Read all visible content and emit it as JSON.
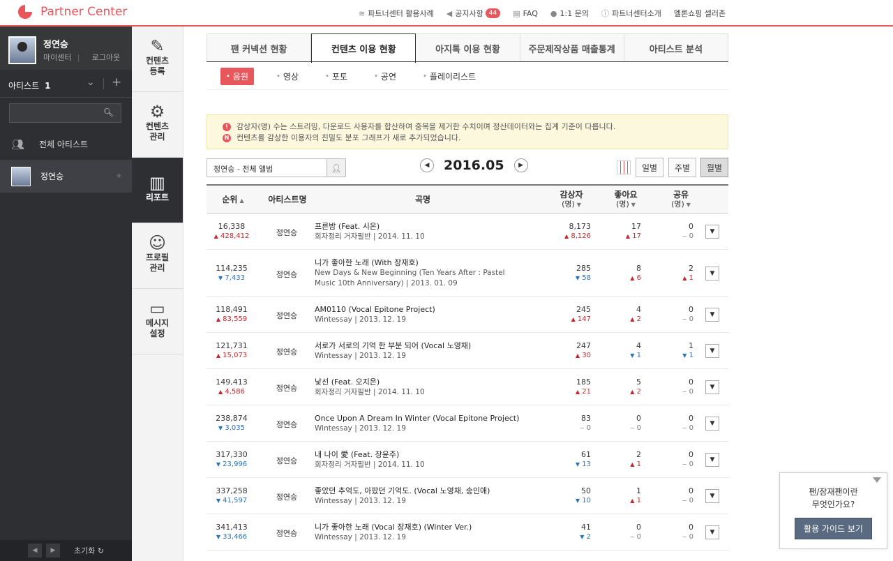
{
  "header": {
    "logo_text": "Partner Center",
    "nav": [
      {
        "label": "파트너센터 활용사례",
        "icon": "layers-icon"
      },
      {
        "label": "공지사항",
        "icon": "megaphone-icon",
        "badge": "44"
      },
      {
        "label": "FAQ",
        "icon": "book-icon"
      },
      {
        "label": "1:1 문의",
        "icon": "chat-icon"
      },
      {
        "label": "파트너센터소개",
        "icon": "info-icon"
      }
    ],
    "seller_link": "멜론쇼핑 셀러존"
  },
  "sidebar": {
    "user_name": "정연승",
    "my_center": "마이센터",
    "logout": "로그아웃",
    "artist_label": "아티스트",
    "artist_count": "1",
    "search_placeholder": "",
    "items": [
      {
        "label": "전체 아티스트"
      },
      {
        "label": "정연승"
      }
    ],
    "reset_label": "초기화"
  },
  "menu": [
    {
      "label": "컨텐츠 등록"
    },
    {
      "label": "컨텐츠 관리"
    },
    {
      "label": "리포트"
    },
    {
      "label": "프로필 관리"
    },
    {
      "label": "메시지 설정"
    }
  ],
  "tabs": [
    {
      "label": "팬 커넥션 현황"
    },
    {
      "label": "컨텐츠 이용 현황"
    },
    {
      "label": "아지톡 이용 현황"
    },
    {
      "label": "주문제작상품 매출통계"
    },
    {
      "label": "아티스트 분석"
    }
  ],
  "subtabs": [
    {
      "label": "음원"
    },
    {
      "label": "영상"
    },
    {
      "label": "포토"
    },
    {
      "label": "공연"
    },
    {
      "label": "플레이리스트"
    }
  ],
  "notice": {
    "line1": "감상자(명) 수는 스트리밍, 다운로드 사용자를 합산하여 중복을 제거한 수치이며 정산데이터와는 집계 기준이 다릅니다.",
    "line2": "컨텐츠를 감상한 이용자의 친밀도 분포 그래프가 새로 추가되었습니다.",
    "icon2_letter": "N"
  },
  "controls": {
    "album_select": "정연승 - 전체 앨범",
    "date": "2016.05",
    "periods": [
      "일별",
      "주별",
      "월별"
    ]
  },
  "table": {
    "headers": {
      "rank": "순위",
      "artist": "아티스트명",
      "song": "곡명",
      "listeners": "감상자",
      "likes": "좋아요",
      "shares": "공유",
      "unit": "(명)"
    },
    "rows": [
      {
        "rank": "16,338",
        "rank_chg": "428,412",
        "rank_dir": "up",
        "artist": "정연승",
        "title": "프른밤 (Feat. 시온)",
        "sub": "회자정리 거자필반   |  2014. 11. 10",
        "listeners": "8,173",
        "listeners_chg": "8,126",
        "listeners_dir": "up",
        "likes": "17",
        "likes_chg": "17",
        "likes_dir": "up",
        "shares": "0",
        "shares_chg": "0",
        "shares_dir": "zero"
      },
      {
        "rank": "114,235",
        "rank_chg": "7,433",
        "rank_dir": "dn",
        "artist": "정연승",
        "title": "니가 좋아한 노래 (With 장재호)",
        "sub": "New Days & New Beginning (Ten Years After : Pastel Music 10th Anniversary)   |  2013. 01. 09",
        "listeners": "285",
        "listeners_chg": "58",
        "listeners_dir": "dn",
        "likes": "8",
        "likes_chg": "6",
        "likes_dir": "up",
        "shares": "2",
        "shares_chg": "1",
        "shares_dir": "up"
      },
      {
        "rank": "118,491",
        "rank_chg": "83,559",
        "rank_dir": "up",
        "artist": "정연승",
        "title": "AM0110 (Vocal Epitone Project)",
        "sub": "Wintessay   |  2013. 12. 19",
        "listeners": "245",
        "listeners_chg": "147",
        "listeners_dir": "up",
        "likes": "4",
        "likes_chg": "2",
        "likes_dir": "up",
        "shares": "0",
        "shares_chg": "0",
        "shares_dir": "zero"
      },
      {
        "rank": "121,731",
        "rank_chg": "15,073",
        "rank_dir": "up",
        "artist": "정연승",
        "title": "서로가 서로의 기억 한 부분 되어 (Vocal 노영채)",
        "sub": "Wintessay   |  2013. 12. 19",
        "listeners": "247",
        "listeners_chg": "30",
        "listeners_dir": "up",
        "likes": "4",
        "likes_chg": "1",
        "likes_dir": "dn",
        "shares": "1",
        "shares_chg": "1",
        "shares_dir": "dn"
      },
      {
        "rank": "149,413",
        "rank_chg": "4,586",
        "rank_dir": "up",
        "artist": "정연승",
        "title": "낯선 (Feat. 오지은)",
        "sub": "회자정리 거자필반   |  2014. 11. 10",
        "listeners": "185",
        "listeners_chg": "21",
        "listeners_dir": "up",
        "likes": "5",
        "likes_chg": "2",
        "likes_dir": "up",
        "shares": "0",
        "shares_chg": "0",
        "shares_dir": "zero"
      },
      {
        "rank": "238,874",
        "rank_chg": "3,035",
        "rank_dir": "dn",
        "artist": "정연승",
        "title": "Once Upon A Dream In Winter (Vocal Epitone Project)",
        "sub": "Wintessay   |  2013. 12. 19",
        "listeners": "83",
        "listeners_chg": "0",
        "listeners_dir": "zero",
        "likes": "0",
        "likes_chg": "0",
        "likes_dir": "zero",
        "shares": "0",
        "shares_chg": "0",
        "shares_dir": "zero"
      },
      {
        "rank": "317,330",
        "rank_chg": "23,996",
        "rank_dir": "dn",
        "artist": "정연승",
        "title": "내 나이 愛 (Feat. 장윤주)",
        "sub": "회자정리 거자필반   |  2014. 11. 10",
        "listeners": "61",
        "listeners_chg": "13",
        "listeners_dir": "dn",
        "likes": "2",
        "likes_chg": "1",
        "likes_dir": "up",
        "shares": "0",
        "shares_chg": "0",
        "shares_dir": "zero"
      },
      {
        "rank": "337,258",
        "rank_chg": "41,597",
        "rank_dir": "dn",
        "artist": "정연승",
        "title": "좋았던 추억도, 아팠던 기억도. (Vocal 노영채, 송인애)",
        "sub": "Wintessay   |  2013. 12. 19",
        "listeners": "50",
        "listeners_chg": "10",
        "listeners_dir": "dn",
        "likes": "1",
        "likes_chg": "1",
        "likes_dir": "up",
        "shares": "0",
        "shares_chg": "0",
        "shares_dir": "zero"
      },
      {
        "rank": "341,413",
        "rank_chg": "33,466",
        "rank_dir": "dn",
        "artist": "정연승",
        "title": "니가 좋아한 노래 (Vocal 장재호) (Winter Ver.)",
        "sub": "Wintessay   |  2013. 12. 19",
        "listeners": "41",
        "listeners_chg": "2",
        "listeners_dir": "dn",
        "likes": "0",
        "likes_chg": "0",
        "likes_dir": "zero",
        "shares": "0",
        "shares_chg": "0",
        "shares_dir": "zero"
      }
    ]
  },
  "help": {
    "question_line1": "팬/잠재팬이란",
    "question_line2": "무엇인가요?",
    "button": "활용 가이드 보기"
  }
}
